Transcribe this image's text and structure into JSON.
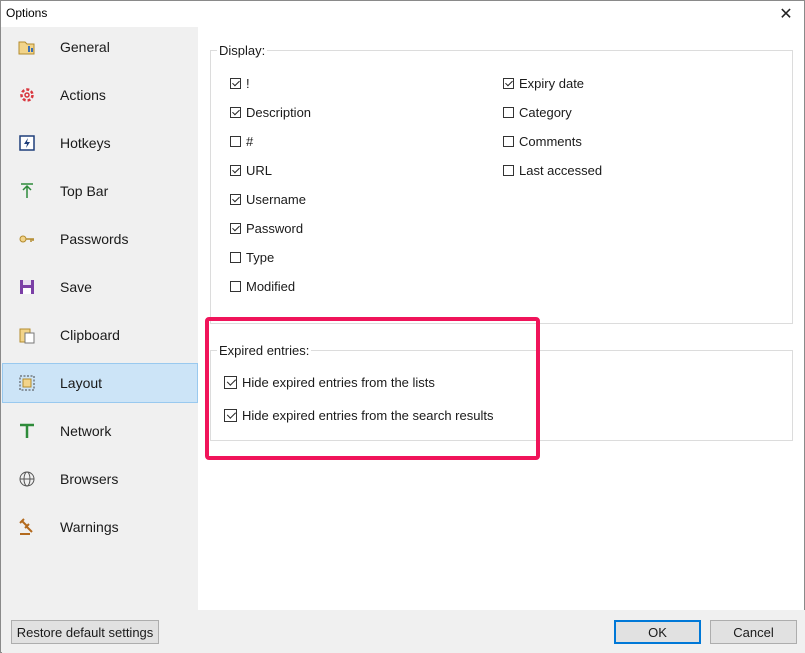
{
  "window": {
    "title": "Options",
    "close_glyph": "✕"
  },
  "sidebar": {
    "items": [
      {
        "label": "General",
        "icon": "general-icon"
      },
      {
        "label": "Actions",
        "icon": "gear-icon"
      },
      {
        "label": "Hotkeys",
        "icon": "hotkey-icon"
      },
      {
        "label": "Top Bar",
        "icon": "topbar-icon"
      },
      {
        "label": "Passwords",
        "icon": "key-icon"
      },
      {
        "label": "Save",
        "icon": "floppy-icon"
      },
      {
        "label": "Clipboard",
        "icon": "clipboard-icon"
      },
      {
        "label": "Layout",
        "icon": "layout-icon",
        "selected": true
      },
      {
        "label": "Network",
        "icon": "network-icon"
      },
      {
        "label": "Browsers",
        "icon": "globe-icon"
      },
      {
        "label": "Warnings",
        "icon": "gavel-icon"
      }
    ]
  },
  "display": {
    "title": "Display:",
    "left": [
      {
        "label": "!",
        "checked": true
      },
      {
        "label": "Description",
        "checked": true
      },
      {
        "label": "#",
        "checked": false
      },
      {
        "label": "URL",
        "checked": true
      },
      {
        "label": "Username",
        "checked": true
      },
      {
        "label": "Password",
        "checked": true
      },
      {
        "label": "Type",
        "checked": false
      },
      {
        "label": "Modified",
        "checked": false
      }
    ],
    "right": [
      {
        "label": "Expiry date",
        "checked": true
      },
      {
        "label": "Category",
        "checked": false
      },
      {
        "label": "Comments",
        "checked": false
      },
      {
        "label": "Last accessed",
        "checked": false
      }
    ]
  },
  "expired": {
    "title": "Expired entries:",
    "options": [
      {
        "label": "Hide expired entries from the lists",
        "checked": true
      },
      {
        "label": "Hide expired entries from the search results",
        "checked": true
      }
    ]
  },
  "footer": {
    "restore_label": "Restore default settings",
    "ok_label": "OK",
    "cancel_label": "Cancel"
  },
  "colors": {
    "highlight": "#f0145a",
    "selected_bg": "#cce4f7",
    "default_button_border": "#0078d7"
  }
}
